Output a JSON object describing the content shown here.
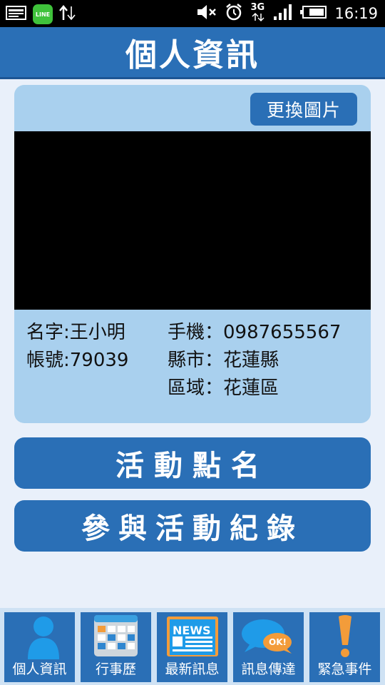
{
  "status_bar": {
    "time": "16:19",
    "line_label": "LINE",
    "network": "3G",
    "icons": [
      "notification-icon",
      "line-icon",
      "data-transfer-icon",
      "mute-icon",
      "alarm-icon",
      "3g-icon",
      "signal-icon",
      "battery-icon"
    ]
  },
  "header": {
    "title": "個人資訊"
  },
  "profile": {
    "change_photo_label": "更換圖片",
    "name": "名字:王小明",
    "account": "帳號:79039",
    "phone": "手機：0987655567",
    "county": "縣市：花蓮縣",
    "district": "區域：花蓮區"
  },
  "actions": {
    "checkin_label": "活動點名",
    "records_label": "參與活動紀錄"
  },
  "bottom_nav": {
    "items": [
      {
        "label": "個人資訊",
        "icon": "person-icon"
      },
      {
        "label": "行事歷",
        "icon": "calendar-icon"
      },
      {
        "label": "最新訊息",
        "icon": "news-icon",
        "badge": "NEWS"
      },
      {
        "label": "訊息傳達",
        "icon": "chat-bubble-icon",
        "badge": "OK!"
      },
      {
        "label": "緊急事件",
        "icon": "exclamation-icon"
      }
    ]
  },
  "colors": {
    "primary": "#2a6fb6",
    "card_background": "#a9d0ee",
    "page_background": "#e9f0fa",
    "nav_background": "#cfe2f4"
  }
}
